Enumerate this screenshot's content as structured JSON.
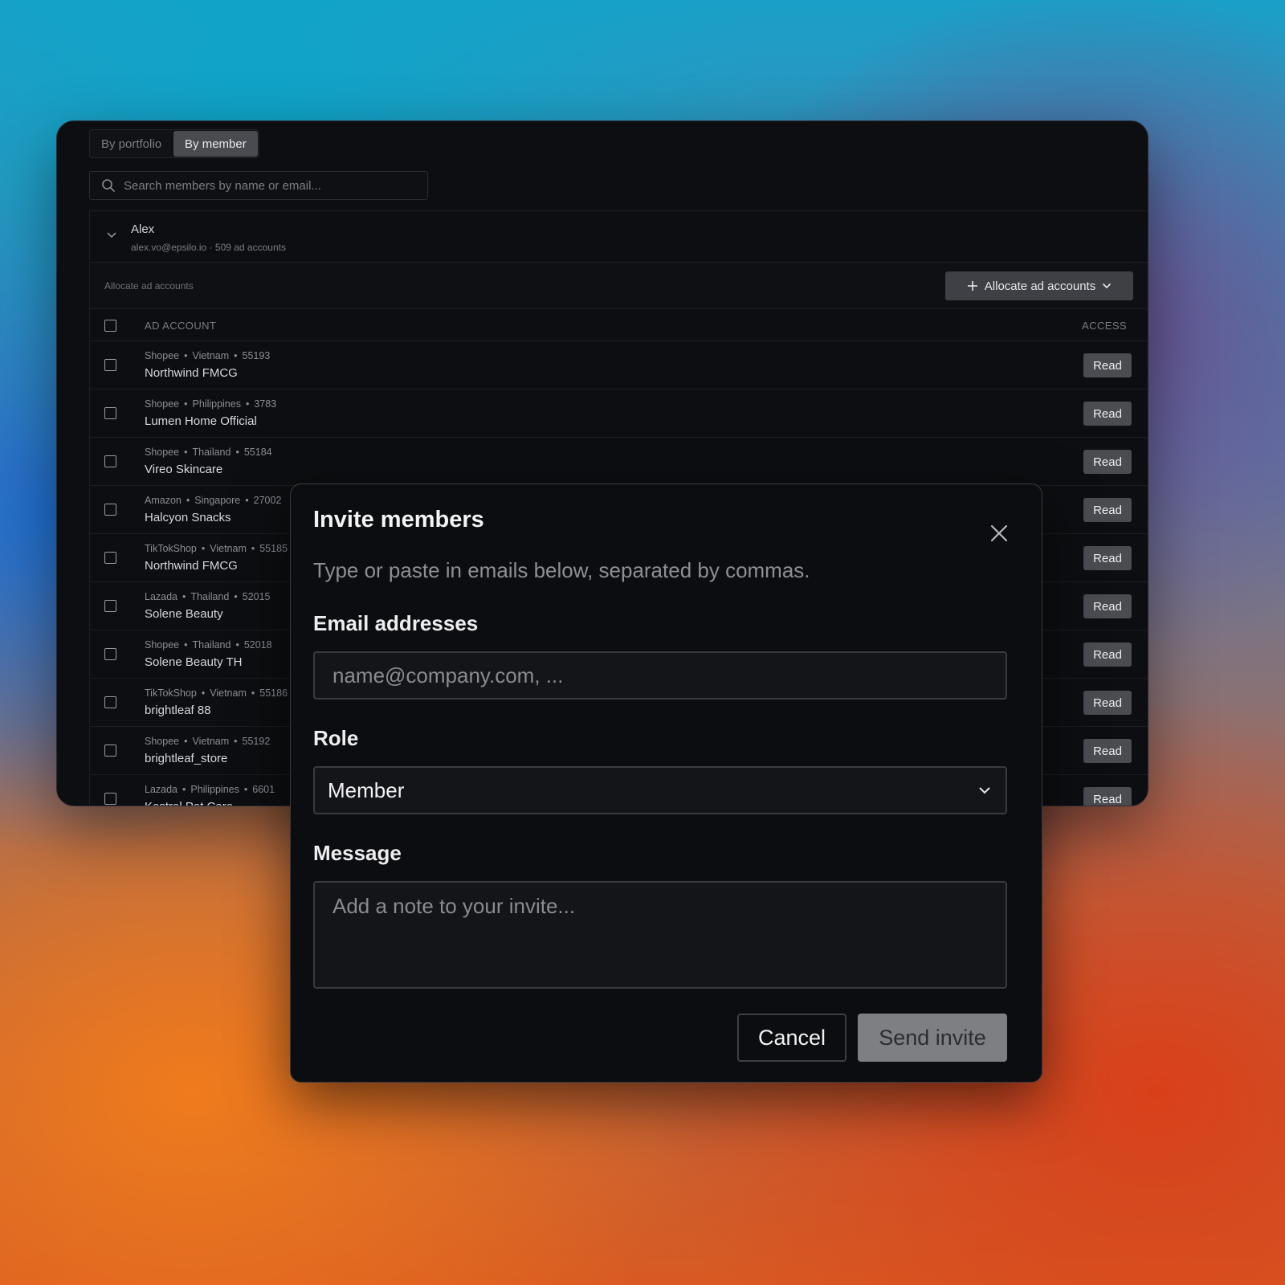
{
  "view_toggle": {
    "by_portfolio": "By portfolio",
    "by_member": "By member",
    "active": "By member"
  },
  "search": {
    "placeholder": "Search members by name or email..."
  },
  "member": {
    "name": "Alex",
    "subtitle": "alex.vo@epsilo.io · 509 ad accounts"
  },
  "allocate": {
    "label": "Allocate ad accounts",
    "button": "Allocate ad accounts"
  },
  "table": {
    "col_account": "AD ACCOUNT",
    "col_access": "ACCESS",
    "rows": [
      {
        "platform": "Shopee",
        "country": "Vietnam",
        "id": "55193",
        "name": "Northwind FMCG",
        "access": "Read"
      },
      {
        "platform": "Shopee",
        "country": "Philippines",
        "id": "3783",
        "name": "Lumen Home Official",
        "access": "Read"
      },
      {
        "platform": "Shopee",
        "country": "Thailand",
        "id": "55184",
        "name": "Vireo Skincare",
        "access": "Read"
      },
      {
        "platform": "Amazon",
        "country": "Singapore",
        "id": "27002",
        "name": "Halcyon Snacks",
        "access": "Read"
      },
      {
        "platform": "TikTokShop",
        "country": "Vietnam",
        "id": "55185",
        "name": "Northwind FMCG",
        "access": "Read"
      },
      {
        "platform": "Lazada",
        "country": "Thailand",
        "id": "52015",
        "name": "Solene Beauty",
        "access": "Read"
      },
      {
        "platform": "Shopee",
        "country": "Thailand",
        "id": "52018",
        "name": "Solene Beauty TH",
        "access": "Read"
      },
      {
        "platform": "TikTokShop",
        "country": "Vietnam",
        "id": "55186",
        "name": "brightleaf 88",
        "access": "Read"
      },
      {
        "platform": "Shopee",
        "country": "Vietnam",
        "id": "55192",
        "name": "brightleaf_store",
        "access": "Read"
      },
      {
        "platform": "Lazada",
        "country": "Philippines",
        "id": "6601",
        "name": "Kestrel Pet Care",
        "access": "Read"
      }
    ]
  },
  "modal": {
    "title": "Invite members",
    "description": "Type or paste in emails below, separated by commas.",
    "email_label": "Email addresses",
    "email_placeholder": "name@company.com, ...",
    "role_label": "Role",
    "role_value": "Member",
    "message_label": "Message",
    "message_placeholder": "Add a note to your invite...",
    "cancel": "Cancel",
    "send": "Send invite"
  },
  "icons": {
    "search": "search-icon",
    "collapse": "chevron-down-icon",
    "plus": "plus-icon",
    "close": "close-icon",
    "dropdown": "chevron-down-icon"
  }
}
